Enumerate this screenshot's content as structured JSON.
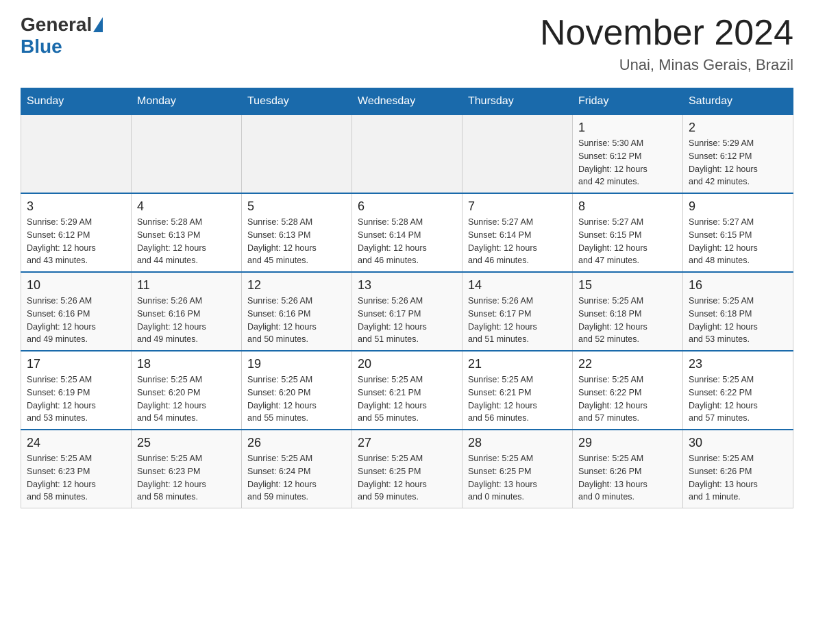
{
  "header": {
    "logo_general": "General",
    "logo_blue": "Blue",
    "month_title": "November 2024",
    "location": "Unai, Minas Gerais, Brazil"
  },
  "days_of_week": [
    "Sunday",
    "Monday",
    "Tuesday",
    "Wednesday",
    "Thursday",
    "Friday",
    "Saturday"
  ],
  "weeks": [
    [
      {
        "day": "",
        "info": ""
      },
      {
        "day": "",
        "info": ""
      },
      {
        "day": "",
        "info": ""
      },
      {
        "day": "",
        "info": ""
      },
      {
        "day": "",
        "info": ""
      },
      {
        "day": "1",
        "info": "Sunrise: 5:30 AM\nSunset: 6:12 PM\nDaylight: 12 hours\nand 42 minutes."
      },
      {
        "day": "2",
        "info": "Sunrise: 5:29 AM\nSunset: 6:12 PM\nDaylight: 12 hours\nand 42 minutes."
      }
    ],
    [
      {
        "day": "3",
        "info": "Sunrise: 5:29 AM\nSunset: 6:12 PM\nDaylight: 12 hours\nand 43 minutes."
      },
      {
        "day": "4",
        "info": "Sunrise: 5:28 AM\nSunset: 6:13 PM\nDaylight: 12 hours\nand 44 minutes."
      },
      {
        "day": "5",
        "info": "Sunrise: 5:28 AM\nSunset: 6:13 PM\nDaylight: 12 hours\nand 45 minutes."
      },
      {
        "day": "6",
        "info": "Sunrise: 5:28 AM\nSunset: 6:14 PM\nDaylight: 12 hours\nand 46 minutes."
      },
      {
        "day": "7",
        "info": "Sunrise: 5:27 AM\nSunset: 6:14 PM\nDaylight: 12 hours\nand 46 minutes."
      },
      {
        "day": "8",
        "info": "Sunrise: 5:27 AM\nSunset: 6:15 PM\nDaylight: 12 hours\nand 47 minutes."
      },
      {
        "day": "9",
        "info": "Sunrise: 5:27 AM\nSunset: 6:15 PM\nDaylight: 12 hours\nand 48 minutes."
      }
    ],
    [
      {
        "day": "10",
        "info": "Sunrise: 5:26 AM\nSunset: 6:16 PM\nDaylight: 12 hours\nand 49 minutes."
      },
      {
        "day": "11",
        "info": "Sunrise: 5:26 AM\nSunset: 6:16 PM\nDaylight: 12 hours\nand 49 minutes."
      },
      {
        "day": "12",
        "info": "Sunrise: 5:26 AM\nSunset: 6:16 PM\nDaylight: 12 hours\nand 50 minutes."
      },
      {
        "day": "13",
        "info": "Sunrise: 5:26 AM\nSunset: 6:17 PM\nDaylight: 12 hours\nand 51 minutes."
      },
      {
        "day": "14",
        "info": "Sunrise: 5:26 AM\nSunset: 6:17 PM\nDaylight: 12 hours\nand 51 minutes."
      },
      {
        "day": "15",
        "info": "Sunrise: 5:25 AM\nSunset: 6:18 PM\nDaylight: 12 hours\nand 52 minutes."
      },
      {
        "day": "16",
        "info": "Sunrise: 5:25 AM\nSunset: 6:18 PM\nDaylight: 12 hours\nand 53 minutes."
      }
    ],
    [
      {
        "day": "17",
        "info": "Sunrise: 5:25 AM\nSunset: 6:19 PM\nDaylight: 12 hours\nand 53 minutes."
      },
      {
        "day": "18",
        "info": "Sunrise: 5:25 AM\nSunset: 6:20 PM\nDaylight: 12 hours\nand 54 minutes."
      },
      {
        "day": "19",
        "info": "Sunrise: 5:25 AM\nSunset: 6:20 PM\nDaylight: 12 hours\nand 55 minutes."
      },
      {
        "day": "20",
        "info": "Sunrise: 5:25 AM\nSunset: 6:21 PM\nDaylight: 12 hours\nand 55 minutes."
      },
      {
        "day": "21",
        "info": "Sunrise: 5:25 AM\nSunset: 6:21 PM\nDaylight: 12 hours\nand 56 minutes."
      },
      {
        "day": "22",
        "info": "Sunrise: 5:25 AM\nSunset: 6:22 PM\nDaylight: 12 hours\nand 57 minutes."
      },
      {
        "day": "23",
        "info": "Sunrise: 5:25 AM\nSunset: 6:22 PM\nDaylight: 12 hours\nand 57 minutes."
      }
    ],
    [
      {
        "day": "24",
        "info": "Sunrise: 5:25 AM\nSunset: 6:23 PM\nDaylight: 12 hours\nand 58 minutes."
      },
      {
        "day": "25",
        "info": "Sunrise: 5:25 AM\nSunset: 6:23 PM\nDaylight: 12 hours\nand 58 minutes."
      },
      {
        "day": "26",
        "info": "Sunrise: 5:25 AM\nSunset: 6:24 PM\nDaylight: 12 hours\nand 59 minutes."
      },
      {
        "day": "27",
        "info": "Sunrise: 5:25 AM\nSunset: 6:25 PM\nDaylight: 12 hours\nand 59 minutes."
      },
      {
        "day": "28",
        "info": "Sunrise: 5:25 AM\nSunset: 6:25 PM\nDaylight: 13 hours\nand 0 minutes."
      },
      {
        "day": "29",
        "info": "Sunrise: 5:25 AM\nSunset: 6:26 PM\nDaylight: 13 hours\nand 0 minutes."
      },
      {
        "day": "30",
        "info": "Sunrise: 5:25 AM\nSunset: 6:26 PM\nDaylight: 13 hours\nand 1 minute."
      }
    ]
  ]
}
